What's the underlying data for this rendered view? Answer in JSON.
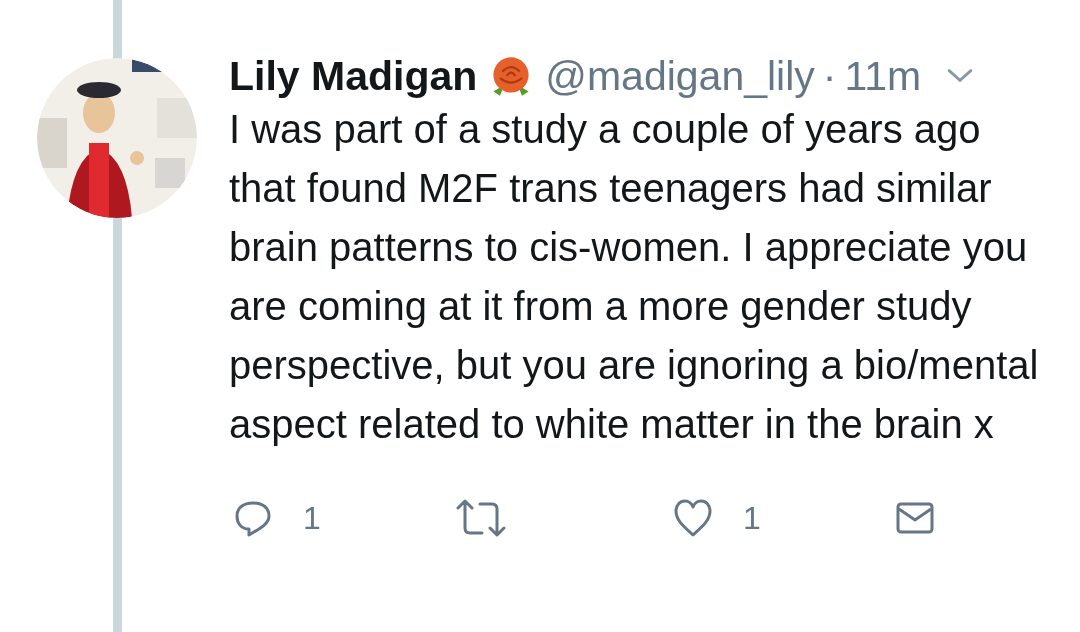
{
  "tweet": {
    "name": "Lily Madigan",
    "handle": "@madigan_lily",
    "separator": "·",
    "time": "11m",
    "text": "I was part of a study a couple of years ago that found M2F trans teenagers had similar brain patterns to cis-women. I appreciate you are coming at it from a more gender study perspective, but you are ignoring a bio/mental aspect related to white matter in the brain x",
    "actions": [
      {
        "kind": "reply",
        "count": "1"
      },
      {
        "kind": "retweet"
      },
      {
        "kind": "like",
        "count": "1"
      },
      {
        "kind": "message"
      }
    ]
  }
}
